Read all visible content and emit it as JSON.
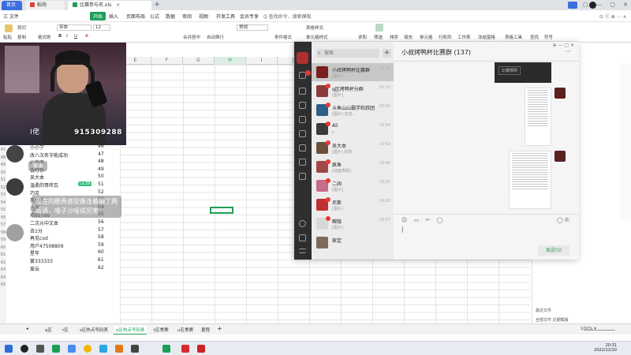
{
  "titlebar": {
    "tabs": [
      {
        "label": "首页"
      },
      {
        "label": "稻壳"
      },
      {
        "label": "比赛参与名.xls"
      }
    ],
    "window_controls": [
      "▢",
      "—",
      "▢",
      "✕"
    ]
  },
  "ribbon": {
    "menu": [
      "三 文件",
      "开始",
      "插入",
      "页面布局",
      "公式",
      "数据",
      "审阅",
      "视图",
      "开发工具",
      "会员专享"
    ],
    "active_menu": "开始",
    "search": "Q 查找命令、搜索模板",
    "right": "⊙ ⓒ ⊕ ⋯ ∧",
    "toolbar": {
      "paste": "粘贴",
      "cut": "剪切",
      "copy": "复制",
      "format_painter": "格式刷",
      "font": "宋体",
      "font_size": "12",
      "merge": "合并居中",
      "wrap": "自动换行",
      "number_format": "常规",
      "table_style": "表格样式",
      "cond_format": "条件格式",
      "cell_style": "单元格样式",
      "sum": "求和",
      "filter": "筛选",
      "sort": "排序",
      "fill": "填充",
      "cell": "单元格",
      "row_col": "行和列",
      "worksheet": "工作表",
      "freeze": "冻结窗格",
      "table_tools": "表格工具",
      "find": "查找",
      "symbol": "符号"
    }
  },
  "sheet": {
    "columns": [
      "E",
      "F",
      "G",
      "H",
      "I",
      "J",
      "K",
      "L",
      "M",
      "N",
      "O",
      "P",
      "Q"
    ],
    "selected_column": "H",
    "row_numbers": [
      "47",
      "48",
      "49",
      "50",
      "51",
      "52",
      "53",
      "54",
      "55",
      "56",
      "57",
      "58",
      "59",
      "60",
      "61",
      "62",
      "63",
      "64",
      "65"
    ],
    "names": [
      {
        "name": "小小宁",
        "value": "46"
      },
      {
        "name": "改八次名字能成功",
        "value": "47"
      },
      {
        "name": "心的天",
        "value": "48"
      },
      {
        "name": "会打你",
        "value": "49"
      },
      {
        "name": "吴大本",
        "value": "50"
      },
      {
        "name": "温柔的哥砖瓦",
        "value": "51"
      },
      {
        "name": "巧克",
        "value": "52"
      },
      {
        "name": "风在的",
        "value": "53"
      },
      {
        "name": "九里",
        "value": "54"
      },
      {
        "name": "欢65790",
        "value": "55"
      },
      {
        "name": "二次元中文本",
        "value": "56"
      },
      {
        "name": "去1分",
        "value": "57"
      },
      {
        "name": "再见cod",
        "value": "58"
      },
      {
        "name": "用户47508809",
        "value": "59"
      },
      {
        "name": "星年",
        "value": "60"
      },
      {
        "name": "宴333333",
        "value": "61"
      },
      {
        "name": "爱云",
        "value": "62"
      }
    ]
  },
  "sheet_tabs": [
    "q区",
    "r区",
    "s区热点号码表",
    "e区热点号码表",
    "t区季赛",
    "u区季赛",
    "夏程"
  ],
  "active_sheet_tab": "e区热点号码表",
  "zoom": "100% ▾",
  "right_pane": {
    "label1": "最近文件",
    "label2": "全部文件  近期模版"
  },
  "stream": {
    "id_text": "915309288",
    "caption_left": "I佬",
    "chat": [
      {
        "name": "佬火",
        "lv": "Lv.38",
        "text": "零来"
      },
      {
        "name": "",
        "lv": "Lv.9",
        "text": "今日人数"
      },
      {
        "name": "",
        "lv": "Lv.29",
        "text": "现在的酷秀感觉像连着抽了两\n瓶酒，嗓子沙哑得厉害"
      },
      {
        "name": "",
        "lv": "Lv.8",
        "text": ""
      }
    ]
  },
  "chat_app": {
    "search_placeholder": "搜索",
    "title": "小叔烤鸭杯比赛群 (137)",
    "more": "···",
    "conversations": [
      {
        "name": "小叔烤鸭杯比赛群",
        "msg": "[图片]",
        "time": "20:31"
      },
      {
        "name": "q区烤鸭杯分群",
        "msg": "[图片]",
        "time": "20:12"
      },
      {
        "name": "斗鱼山山霸学和叔团",
        "msg": "[图片] 欢迎...",
        "time": "20:01"
      },
      {
        "name": "Ali",
        "msg": "z",
        "time": "19:54"
      },
      {
        "name": "吴大本",
        "msg": "[图片] 好的",
        "time": "19:52"
      },
      {
        "name": "疯鱼",
        "msg": "[动画表情]",
        "time": "19:40"
      },
      {
        "name": "二阔",
        "msg": "[图片]",
        "time": "19:21"
      },
      {
        "name": "尼斯",
        "msg": "[图片]",
        "time": "19:02"
      },
      {
        "name": "瞬隐",
        "msg": "[图片]",
        "time": "18:57"
      },
      {
        "name": "家定",
        "msg": "",
        "time": ""
      }
    ],
    "image_msg_label": "比赛规则",
    "send_label": "发送(S)",
    "tools": [
      "☺",
      "▭",
      "✂",
      "◯"
    ],
    "tools_right": [
      "◯",
      "✆"
    ]
  },
  "clock": {
    "time": "20:31",
    "date": "2022/12/10"
  }
}
